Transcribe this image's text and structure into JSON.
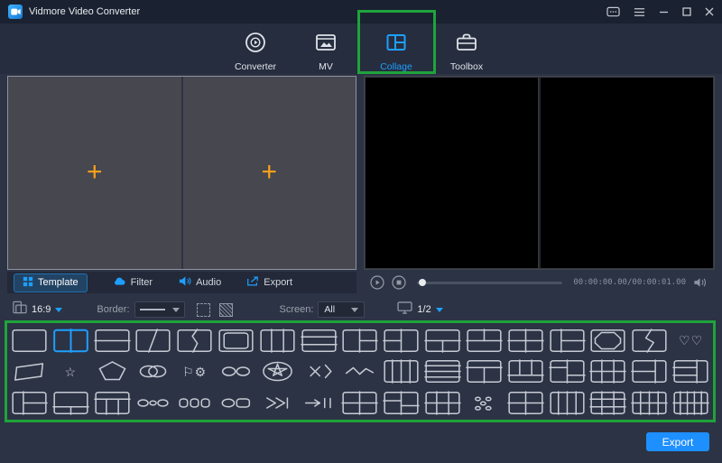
{
  "window": {
    "title": "Vidmore Video Converter"
  },
  "titlebar_icons": [
    "feedback-icon",
    "menu-icon",
    "minimize-icon",
    "maximize-icon",
    "close-icon"
  ],
  "nav": {
    "tabs": [
      {
        "label": "Converter",
        "icon": "converter-disc-icon",
        "active": false
      },
      {
        "label": "MV",
        "icon": "mv-picture-icon",
        "active": false
      },
      {
        "label": "Collage",
        "icon": "collage-grid-icon",
        "active": true
      },
      {
        "label": "Toolbox",
        "icon": "toolbox-case-icon",
        "active": false
      }
    ]
  },
  "collage_panels": {
    "count": 2,
    "placeholder_glyph": "+"
  },
  "left_tabs": [
    {
      "label": "Template",
      "icon": "template-grid-icon",
      "active": true
    },
    {
      "label": "Filter",
      "icon": "filter-cloud-icon",
      "active": false
    },
    {
      "label": "Audio",
      "icon": "audio-speaker-icon",
      "active": false
    },
    {
      "label": "Export",
      "icon": "export-arrow-icon",
      "active": false
    }
  ],
  "player": {
    "time": "00:00:00.00/00:00:01.00",
    "progress_percent": 4,
    "icons": [
      "play-icon",
      "stop-icon",
      "volume-icon"
    ]
  },
  "toolbar": {
    "ratio": "16:9",
    "border_label": "Border:",
    "screen_label": "Screen:",
    "screen_value": "All",
    "page": "1/2",
    "icons": [
      "aspect-ratio-icon",
      "dashed-border-icon",
      "hatch-pattern-icon",
      "monitor-icon"
    ]
  },
  "export": {
    "label": "Export"
  },
  "colors": {
    "accent": "#1e9fff",
    "annotation_green": "#1fa33c",
    "plus_orange": "#ffa21a",
    "export_blue": "#1e8fff"
  },
  "templates": {
    "selected": "two-vertical",
    "rows": [
      [
        {
          "n": "blank",
          "l": []
        },
        {
          "n": "two-vertical",
          "sel": true,
          "l": [
            [
              50,
              0,
              50,
              100
            ]
          ]
        },
        {
          "n": "two-horizontal",
          "l": [
            [
              0,
              50,
              100,
              50
            ]
          ]
        },
        {
          "n": "diagonal",
          "l": [
            [
              62,
              0,
              38,
              100
            ]
          ]
        },
        {
          "n": "curve",
          "l": [
            [
              58,
              0,
              44,
              30
            ],
            [
              44,
              30,
              58,
              62
            ],
            [
              58,
              62,
              46,
              100
            ]
          ]
        },
        {
          "n": "rounded-inset",
          "r": [
            [
              16,
              16,
              68,
              68
            ]
          ]
        },
        {
          "n": "three-vertical",
          "l": [
            [
              33,
              0,
              33,
              100
            ],
            [
              67,
              0,
              67,
              100
            ]
          ]
        },
        {
          "n": "three-horizontal",
          "l": [
            [
              0,
              33,
              100,
              33
            ],
            [
              0,
              67,
              100,
              67
            ]
          ]
        },
        {
          "n": "right-split",
          "l": [
            [
              50,
              0,
              50,
              100
            ],
            [
              50,
              50,
              100,
              50
            ]
          ]
        },
        {
          "n": "left-split",
          "l": [
            [
              50,
              0,
              50,
              100
            ],
            [
              0,
              50,
              50,
              50
            ]
          ]
        },
        {
          "n": "bottom-split",
          "l": [
            [
              0,
              50,
              100,
              50
            ],
            [
              50,
              50,
              50,
              100
            ]
          ]
        },
        {
          "n": "top-split",
          "l": [
            [
              0,
              50,
              100,
              50
            ],
            [
              50,
              0,
              50,
              50
            ]
          ]
        },
        {
          "n": "grid-2x2",
          "l": [
            [
              50,
              0,
              50,
              100
            ],
            [
              0,
              50,
              100,
              50
            ]
          ]
        },
        {
          "n": "offset-grid",
          "l": [
            [
              33,
              0,
              33,
              100
            ],
            [
              33,
              50,
              100,
              50
            ]
          ]
        },
        {
          "n": "octagon-inset",
          "l": [
            [
              32,
              14,
              68,
              14
            ],
            [
              68,
              14,
              86,
              40
            ],
            [
              86,
              40,
              86,
              60
            ],
            [
              86,
              60,
              68,
              86
            ],
            [
              68,
              86,
              32,
              86
            ],
            [
              32,
              86,
              14,
              60
            ],
            [
              14,
              60,
              14,
              40
            ],
            [
              14,
              40,
              32,
              14
            ]
          ]
        },
        {
          "n": "zigzag",
          "l": [
            [
              56,
              0,
              40,
              38
            ],
            [
              40,
              38,
              62,
              58
            ],
            [
              62,
              58,
              44,
              100
            ]
          ]
        },
        {
          "n": "hearts",
          "ch": "♡♡",
          "nf": true
        }
      ],
      [
        {
          "n": "banner",
          "nf": true,
          "l": [
            [
              14,
              32,
              88,
              16
            ],
            [
              88,
              16,
              84,
              72
            ],
            [
              84,
              72,
              10,
              88
            ],
            [
              10,
              88,
              14,
              32
            ]
          ]
        },
        {
          "n": "star",
          "ch": "☆",
          "nf": true
        },
        {
          "n": "pentagon",
          "nf": true,
          "l": [
            [
              50,
              8,
              86,
              38
            ],
            [
              86,
              38,
              70,
              86
            ],
            [
              70,
              86,
              30,
              86
            ],
            [
              30,
              86,
              14,
              38
            ],
            [
              14,
              38,
              50,
              8
            ]
          ]
        },
        {
          "n": "overlap-circles",
          "nf": true,
          "c": [
            [
              38,
              50,
              24
            ],
            [
              62,
              50,
              24
            ]
          ]
        },
        {
          "n": "flag-gear",
          "ch": "⚐⚙",
          "nf": true
        },
        {
          "n": "two-circles",
          "nf": true,
          "c": [
            [
              30,
              50,
              18
            ],
            [
              70,
              50,
              18
            ]
          ]
        },
        {
          "n": "star-badge",
          "nf": true,
          "c": [
            [
              50,
              50,
              40
            ]
          ],
          "l": [
            [
              50,
              18,
              62,
              68
            ],
            [
              62,
              68,
              24,
              38
            ],
            [
              24,
              38,
              76,
              38
            ],
            [
              76,
              38,
              38,
              68
            ],
            [
              38,
              68,
              50,
              18
            ]
          ]
        },
        {
          "n": "cross-bracket",
          "nf": true,
          "l": [
            [
              26,
              30,
              52,
              70
            ],
            [
              52,
              30,
              26,
              70
            ],
            [
              68,
              22,
              84,
              50
            ],
            [
              84,
              50,
              68,
              78
            ]
          ]
        },
        {
          "n": "wave",
          "nf": true,
          "l": [
            [
              12,
              58,
              32,
              34
            ],
            [
              32,
              34,
              50,
              62
            ],
            [
              50,
              62,
              68,
              38
            ],
            [
              68,
              38,
              88,
              55
            ]
          ]
        },
        {
          "n": "four-vertical",
          "l": [
            [
              25,
              0,
              25,
              100
            ],
            [
              50,
              0,
              50,
              100
            ],
            [
              75,
              0,
              75,
              100
            ]
          ]
        },
        {
          "n": "four-horizontal",
          "l": [
            [
              0,
              25,
              100,
              25
            ],
            [
              0,
              50,
              100,
              50
            ],
            [
              0,
              75,
              100,
              75
            ]
          ]
        },
        {
          "n": "top-bottom-split",
          "l": [
            [
              0,
              33,
              100,
              33
            ],
            [
              50,
              33,
              50,
              100
            ]
          ]
        },
        {
          "n": "columns-bottom",
          "l": [
            [
              33,
              0,
              33,
              67
            ],
            [
              67,
              0,
              67,
              67
            ],
            [
              0,
              67,
              100,
              67
            ]
          ]
        },
        {
          "n": "stagger",
          "l": [
            [
              50,
              0,
              50,
              100
            ],
            [
              0,
              33,
              50,
              33
            ],
            [
              50,
              67,
              100,
              67
            ]
          ]
        },
        {
          "n": "grid-2x3",
          "l": [
            [
              33,
              0,
              33,
              100
            ],
            [
              67,
              0,
              67,
              100
            ],
            [
              0,
              50,
              100,
              50
            ]
          ]
        },
        {
          "n": "side-panel",
          "l": [
            [
              67,
              0,
              67,
              100
            ],
            [
              0,
              50,
              67,
              50
            ]
          ]
        },
        {
          "n": "left-rows",
          "l": [
            [
              67,
              0,
              67,
              100
            ],
            [
              0,
              33,
              67,
              33
            ],
            [
              0,
              67,
              67,
              67
            ]
          ]
        }
      ],
      [
        {
          "n": "left-column-rows",
          "l": [
            [
              33,
              0,
              33,
              100
            ],
            [
              33,
              50,
              100,
              50
            ]
          ]
        },
        {
          "n": "bottom-row-split",
          "l": [
            [
              0,
              67,
              100,
              67
            ],
            [
              50,
              67,
              50,
              100
            ]
          ]
        },
        {
          "n": "top-row-columns",
          "l": [
            [
              0,
              33,
              100,
              33
            ],
            [
              33,
              33,
              33,
              100
            ],
            [
              67,
              33,
              67,
              100
            ]
          ]
        },
        {
          "n": "three-circles",
          "nf": true,
          "c": [
            [
              22,
              50,
              14
            ],
            [
              50,
              50,
              9
            ],
            [
              78,
              50,
              14
            ]
          ]
        },
        {
          "n": "three-squares",
          "nf": true,
          "r": [
            [
              8,
              32,
              22,
              36
            ],
            [
              39,
              32,
              22,
              36
            ],
            [
              70,
              32,
              22,
              36
            ]
          ]
        },
        {
          "n": "circle-square",
          "nf": true,
          "c": [
            [
              28,
              50,
              17
            ]
          ],
          "r": [
            [
              52,
              32,
              36,
              36
            ]
          ]
        },
        {
          "n": "fast-forward",
          "nf": true,
          "l": [
            [
              20,
              28,
              44,
              50
            ],
            [
              44,
              50,
              20,
              72
            ],
            [
              46,
              28,
              70,
              50
            ],
            [
              70,
              50,
              46,
              72
            ],
            [
              78,
              28,
              78,
              72
            ]
          ]
        },
        {
          "n": "arrow-bars",
          "nf": true,
          "l": [
            [
              12,
              50,
              52,
              50
            ],
            [
              38,
              36,
              52,
              50
            ],
            [
              38,
              64,
              52,
              50
            ],
            [
              66,
              30,
              66,
              70
            ],
            [
              82,
              30,
              82,
              70
            ]
          ]
        },
        {
          "n": "grid-2x2-b",
          "l": [
            [
              50,
              0,
              50,
              100
            ],
            [
              0,
              50,
              100,
              50
            ]
          ]
        },
        {
          "n": "grid-offset",
          "l": [
            [
              50,
              0,
              50,
              100
            ],
            [
              0,
              40,
              50,
              40
            ],
            [
              50,
              62,
              100,
              62
            ]
          ]
        },
        {
          "n": "grid-3x2",
          "l": [
            [
              33,
              0,
              33,
              100
            ],
            [
              67,
              0,
              67,
              100
            ],
            [
              0,
              50,
              100,
              50
            ]
          ]
        },
        {
          "n": "dots",
          "nf": true,
          "c": [
            [
              32,
              32,
              7
            ],
            [
              62,
              32,
              7
            ],
            [
              47,
              52,
              7
            ],
            [
              32,
              73,
              7
            ],
            [
              62,
              73,
              7
            ]
          ]
        },
        {
          "n": "grid-2x2-c",
          "l": [
            [
              50,
              0,
              50,
              100
            ],
            [
              0,
              50,
              100,
              50
            ]
          ]
        },
        {
          "n": "four-columns",
          "l": [
            [
              25,
              0,
              25,
              100
            ],
            [
              50,
              0,
              50,
              100
            ],
            [
              75,
              0,
              75,
              100
            ]
          ]
        },
        {
          "n": "grid-3x3",
          "l": [
            [
              33,
              0,
              33,
              100
            ],
            [
              67,
              0,
              67,
              100
            ],
            [
              0,
              33,
              100,
              33
            ],
            [
              0,
              67,
              100,
              67
            ]
          ]
        },
        {
          "n": "grid-4x2",
          "l": [
            [
              25,
              0,
              25,
              100
            ],
            [
              50,
              0,
              50,
              100
            ],
            [
              75,
              0,
              75,
              100
            ],
            [
              0,
              50,
              100,
              50
            ]
          ]
        },
        {
          "n": "grid-5x2",
          "l": [
            [
              20,
              0,
              20,
              100
            ],
            [
              40,
              0,
              40,
              100
            ],
            [
              60,
              0,
              60,
              100
            ],
            [
              80,
              0,
              80,
              100
            ],
            [
              0,
              50,
              100,
              50
            ]
          ]
        }
      ]
    ]
  }
}
